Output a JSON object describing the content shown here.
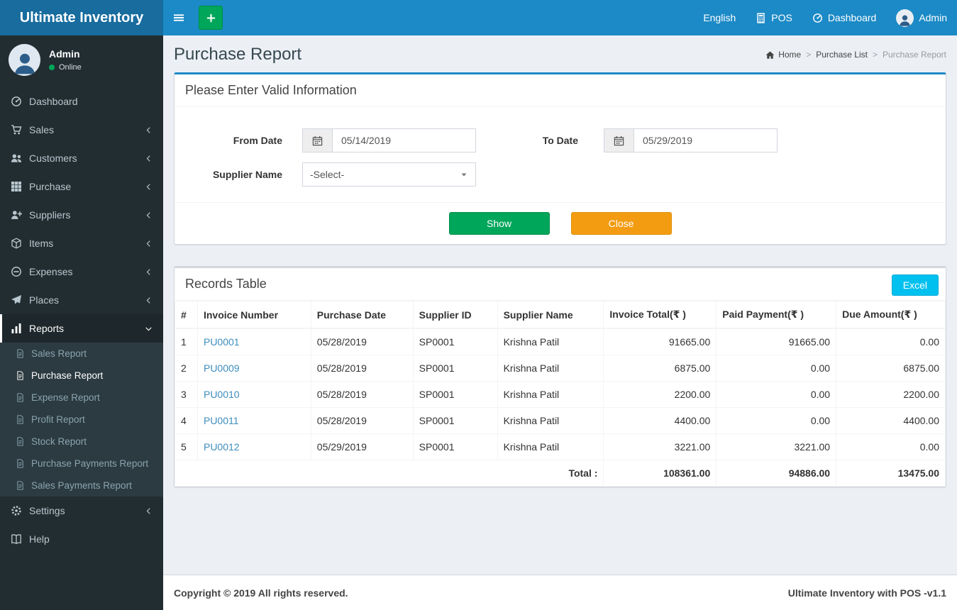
{
  "brand": {
    "title": "Ultimate Inventory"
  },
  "navbar": {
    "language": "English",
    "pos_label": "POS",
    "dashboard_label": "Dashboard",
    "user_label": "Admin"
  },
  "sidebar": {
    "user_name": "Admin",
    "user_status": "Online",
    "menu": [
      {
        "label": "Dashboard",
        "icon": "dashboard-icon",
        "expandable": false
      },
      {
        "label": "Sales",
        "icon": "cart-icon",
        "expandable": true
      },
      {
        "label": "Customers",
        "icon": "users-icon",
        "expandable": true
      },
      {
        "label": "Purchase",
        "icon": "grid-icon",
        "expandable": true
      },
      {
        "label": "Suppliers",
        "icon": "user-plus-icon",
        "expandable": true
      },
      {
        "label": "Items",
        "icon": "items-icon",
        "expandable": true
      },
      {
        "label": "Expenses",
        "icon": "minus-circle-icon",
        "expandable": true
      },
      {
        "label": "Places",
        "icon": "paper-plane-icon",
        "expandable": true
      },
      {
        "label": "Reports",
        "icon": "bar-chart-icon",
        "expandable": true,
        "expanded": true,
        "active": true,
        "children": [
          "Sales Report",
          "Purchase Report",
          "Expense Report",
          "Profit Report",
          "Stock Report",
          "Purchase Payments Report",
          "Sales Payments Report"
        ],
        "active_child": "Purchase Report"
      },
      {
        "label": "Settings",
        "icon": "gear-icon",
        "expandable": true
      },
      {
        "label": "Help",
        "icon": "book-icon",
        "expandable": false
      }
    ]
  },
  "page": {
    "title": "Purchase Report",
    "breadcrumb": [
      "Home",
      "Purchase List",
      "Purchase Report"
    ],
    "breadcrumb_separator": ">"
  },
  "filter_panel": {
    "heading": "Please Enter Valid Information",
    "from_date_label": "From Date",
    "from_date_value": "05/14/2019",
    "to_date_label": "To Date",
    "to_date_value": "05/29/2019",
    "supplier_label": "Supplier Name",
    "supplier_value": "-Select-",
    "show_button": "Show",
    "close_button": "Close"
  },
  "records": {
    "heading": "Records Table",
    "excel_button": "Excel",
    "columns": [
      "#",
      "Invoice Number",
      "Purchase Date",
      "Supplier ID",
      "Supplier Name",
      "Invoice Total(₹ )",
      "Paid Payment(₹ )",
      "Due Amount(₹ )"
    ],
    "rows": [
      [
        "1",
        "PU0001",
        "05/28/2019",
        "SP0001",
        "Krishna Patil",
        "91665.00",
        "91665.00",
        "0.00"
      ],
      [
        "2",
        "PU0009",
        "05/28/2019",
        "SP0001",
        "Krishna Patil",
        "6875.00",
        "0.00",
        "6875.00"
      ],
      [
        "3",
        "PU0010",
        "05/28/2019",
        "SP0001",
        "Krishna Patil",
        "2200.00",
        "0.00",
        "2200.00"
      ],
      [
        "4",
        "PU0011",
        "05/28/2019",
        "SP0001",
        "Krishna Patil",
        "4400.00",
        "0.00",
        "4400.00"
      ],
      [
        "5",
        "PU0012",
        "05/29/2019",
        "SP0001",
        "Krishna Patil",
        "3221.00",
        "3221.00",
        "0.00"
      ]
    ],
    "total_label": "Total :",
    "totals": [
      "108361.00",
      "94886.00",
      "13475.00"
    ]
  },
  "footer": {
    "copyright": "Copyright © 2019 All rights reserved.",
    "version": "Ultimate Inventory with POS -v1.1"
  },
  "colors": {
    "navbar": "#1c8ac6",
    "brand_bg": "#186c9e",
    "sidebar_bg": "#222d32",
    "submenu_bg": "#2c3b41",
    "link_blue": "#3c8dbc",
    "success_green": "#00a65a",
    "warning_orange": "#f39c12",
    "info_blue": "#00c0ef"
  }
}
